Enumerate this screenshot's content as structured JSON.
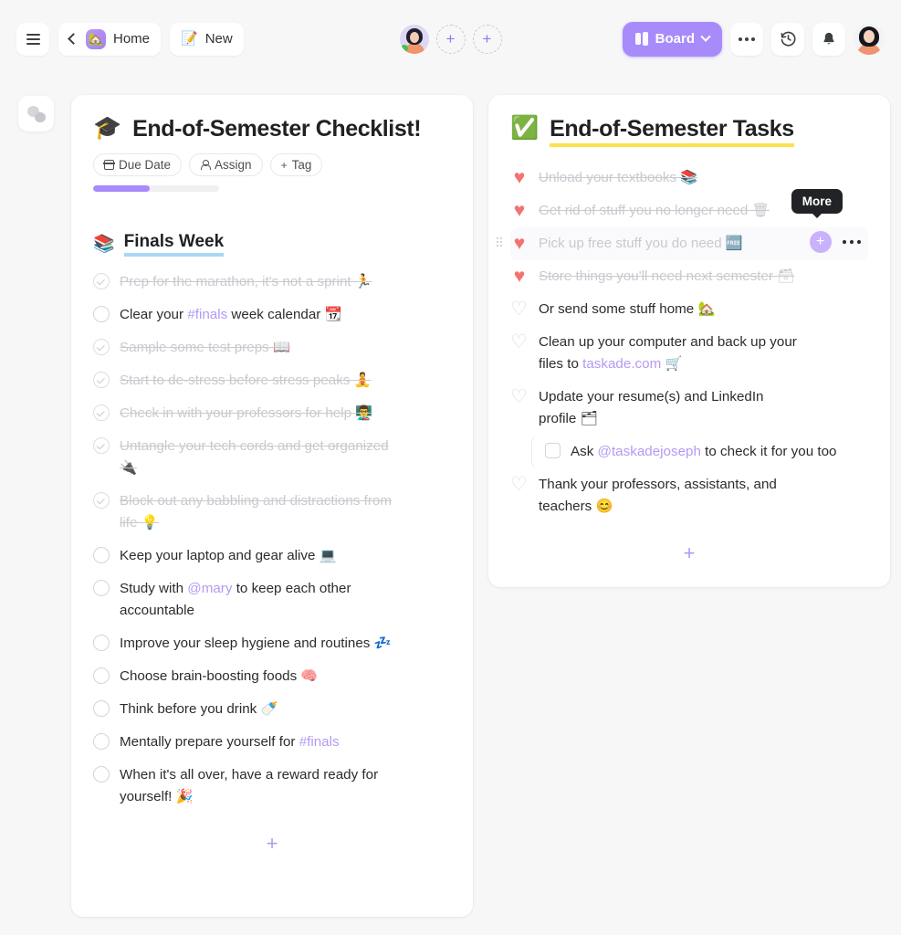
{
  "topbar": {
    "menu_icon": "hamburger-icon",
    "back_icon": "chevron-left-icon",
    "home_label": "Home",
    "home_emoji": "🏡",
    "new_label": "New",
    "new_icon": "compose-icon",
    "new_emoji": "📝",
    "view_label": "Board",
    "view_icon": "board-layout-icon",
    "more_icon": "ellipsis-icon",
    "history_icon": "history-clock-icon",
    "bell_icon": "bell-icon",
    "avatar_icon": "user-avatar"
  },
  "rail": {
    "chat_icon": "chat-bubbles-icon"
  },
  "cards": [
    {
      "id": "checklist-card",
      "emoji": "🎓",
      "title": "End-of-Semester Checklist!",
      "title_underline": "none",
      "chips": [
        {
          "name": "due-date",
          "label": "Due Date",
          "icon": "calendar-icon"
        },
        {
          "name": "assign",
          "label": "Assign",
          "icon": "person-icon"
        },
        {
          "name": "tag",
          "label": "Tag",
          "icon": "plus-icon"
        }
      ],
      "progress_percent": 45,
      "progress_color": "#a78bfa",
      "section": {
        "emoji": "📚",
        "title": "Finals Week",
        "underline_color": "#a8d8f5"
      },
      "items": [
        {
          "state": "done",
          "marker": "circle",
          "text": "Prep for the marathon, it's not a sprint 🏃"
        },
        {
          "state": "open",
          "marker": "circle",
          "text": "Clear your ",
          "tag": "#finals",
          "text_after": " week calendar 📆"
        },
        {
          "state": "done",
          "marker": "circle",
          "text": "Sample some test preps 📖"
        },
        {
          "state": "done",
          "marker": "circle",
          "text": "Start to de-stress before stress peaks 🧘"
        },
        {
          "state": "done",
          "marker": "circle",
          "text": "Check in with your professors for help 👨‍🏫"
        },
        {
          "state": "done",
          "marker": "circle",
          "text": "Untangle your tech cords and get organized 🔌"
        },
        {
          "state": "done",
          "marker": "circle",
          "text": "Block out any babbling and distractions from life 💡"
        },
        {
          "state": "open",
          "marker": "circle",
          "text": "Keep your laptop and gear alive 💻"
        },
        {
          "state": "open",
          "marker": "circle",
          "text": "Study with ",
          "mention": "@mary",
          "text_after": " to keep each other accountable"
        },
        {
          "state": "open",
          "marker": "circle",
          "text": "Improve your sleep hygiene and routines 💤"
        },
        {
          "state": "open",
          "marker": "circle",
          "text": "Choose brain-boosting foods 🧠"
        },
        {
          "state": "open",
          "marker": "circle",
          "text": "Think before you drink 🍼"
        },
        {
          "state": "open",
          "marker": "circle",
          "text": "Mentally prepare yourself for ",
          "tag": "#finals",
          "text_after": ""
        },
        {
          "state": "open",
          "marker": "circle",
          "text": "When it's all over, have a reward ready for yourself! 🎉"
        }
      ],
      "add_label": "+"
    },
    {
      "id": "tasks-card",
      "emoji": "✅",
      "title": "End-of-Semester Tasks",
      "title_underline": "#fde14f",
      "items": [
        {
          "state": "done",
          "marker": "heart",
          "text": "Unload your textbooks 📚"
        },
        {
          "state": "done",
          "marker": "heart",
          "text": "Get rid of stuff you no longer need 🗑"
        },
        {
          "state": "done",
          "marker": "heart",
          "text": "Pick up free stuff you do need 🆓",
          "hovered": true
        },
        {
          "state": "done",
          "marker": "heart",
          "text": "Store things you'll need next semester 🗃"
        },
        {
          "state": "open",
          "marker": "heart",
          "text": "Or send some stuff home 🏡"
        },
        {
          "state": "open",
          "marker": "heart",
          "text": "Clean up your computer and back up your files to ",
          "link": "taskade.com",
          "text_after": " 🛒"
        },
        {
          "state": "open",
          "marker": "heart",
          "text": "Update your resume(s) and LinkedIn profile 🗂"
        },
        {
          "state": "open",
          "marker": "square",
          "sub": true,
          "text": "Ask ",
          "mention": "@taskadejoseph",
          "text_after": " to check it for you too"
        },
        {
          "state": "open",
          "marker": "heart",
          "text": "Thank your professors, assistants, and teachers 😊"
        }
      ],
      "hover_tooltip": "More",
      "hover_add_icon": "plus-icon",
      "hover_more_icon": "ellipsis-icon",
      "hover_drag_icon": "drag-handle-icon",
      "add_label": "+"
    }
  ]
}
